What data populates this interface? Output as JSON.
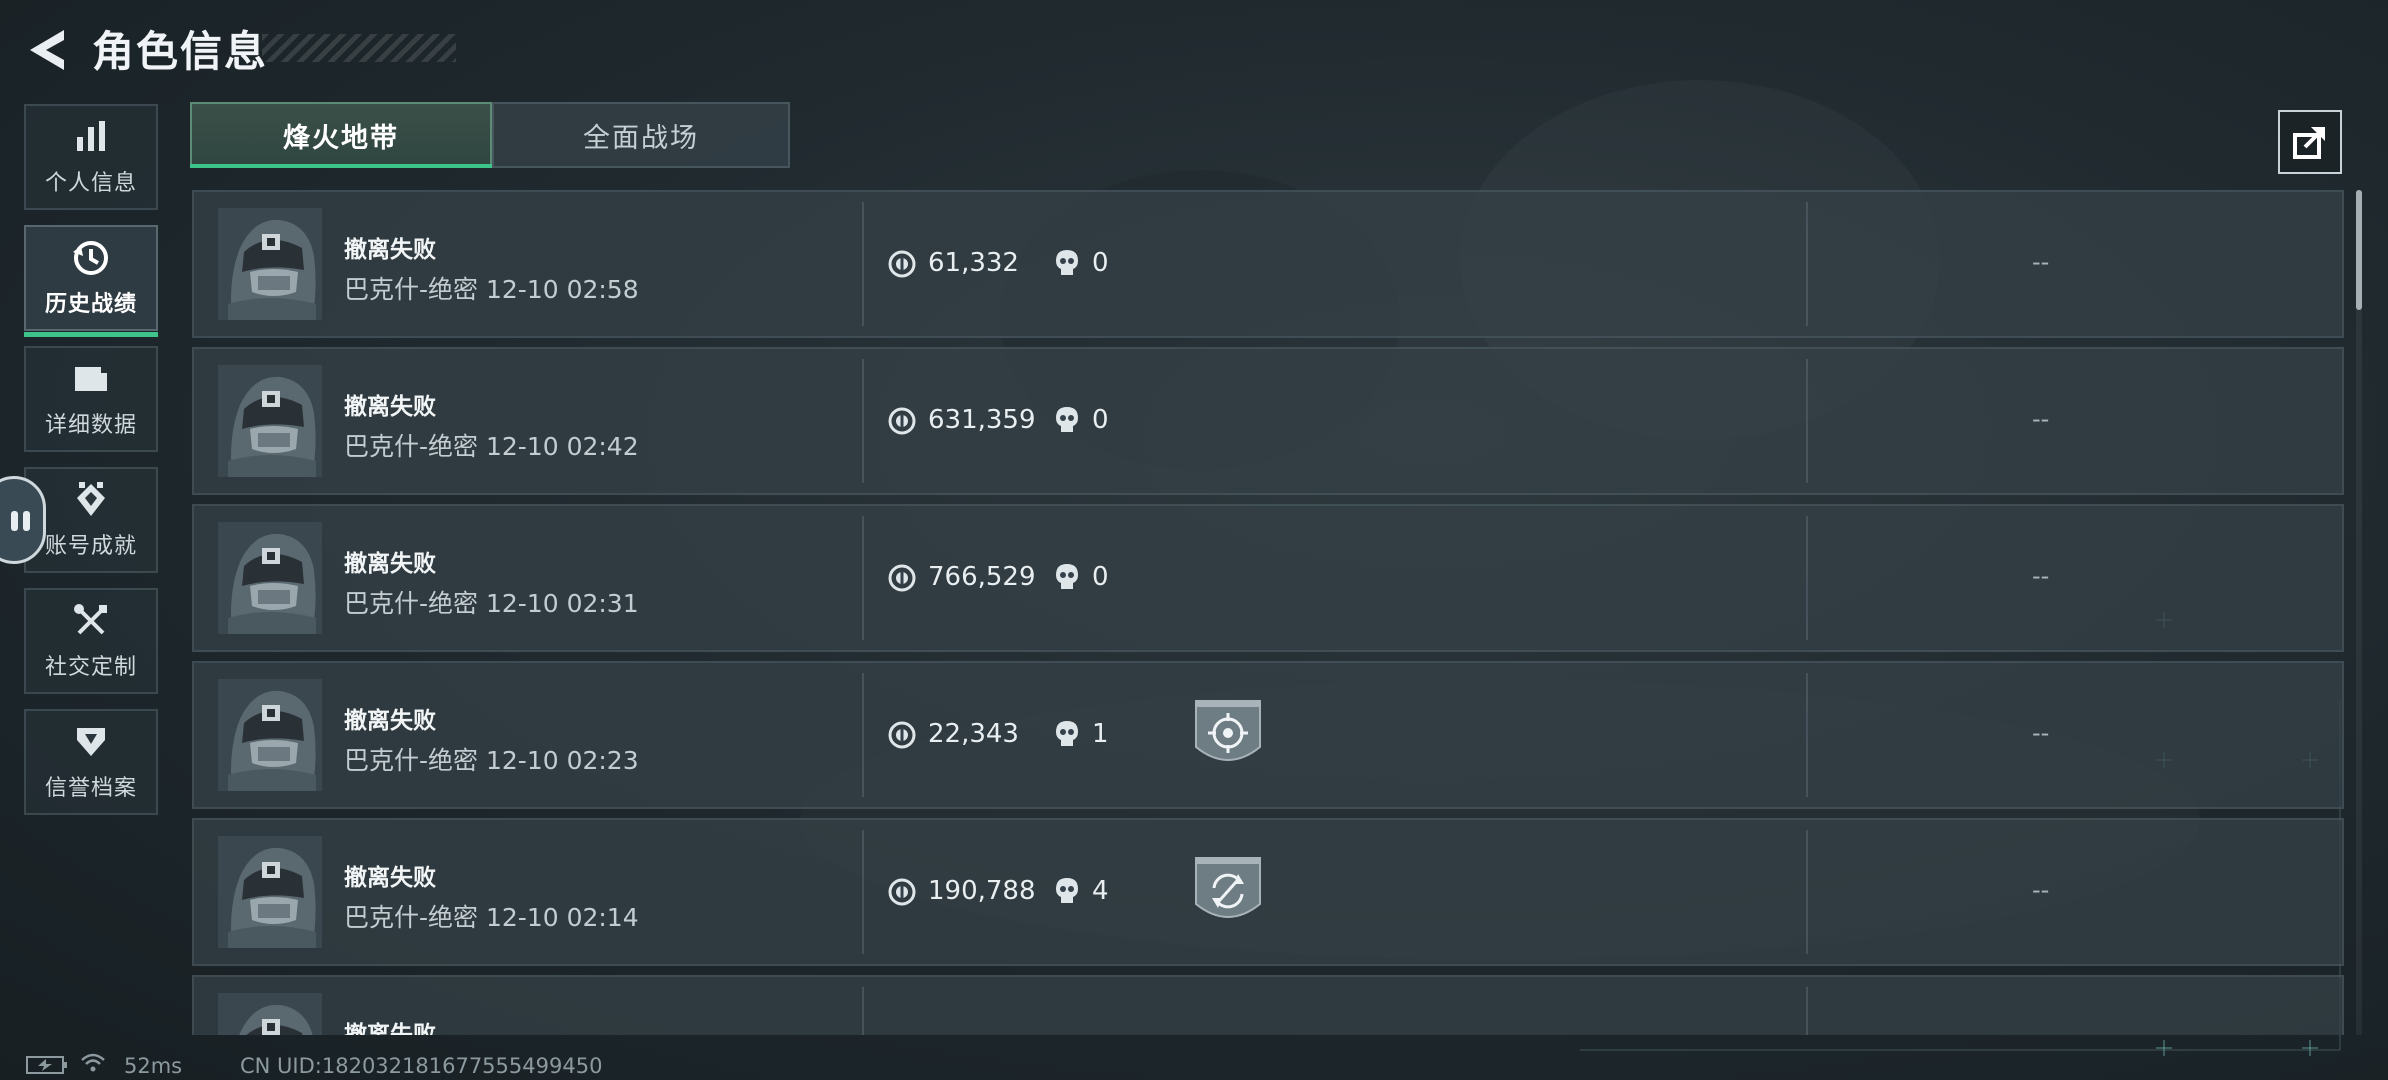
{
  "header": {
    "title": "角色信息",
    "back_icon": "back-arrow-icon"
  },
  "sidebar": {
    "items": [
      {
        "label": "个人信息",
        "icon": "bar-chart-icon",
        "active": false
      },
      {
        "label": "历史战绩",
        "icon": "history-clock-icon",
        "active": true
      },
      {
        "label": "详细数据",
        "icon": "folder-icon",
        "active": false
      },
      {
        "label": "账号成就",
        "icon": "achievement-badge-icon",
        "active": false
      },
      {
        "label": "社交定制",
        "icon": "tools-icon",
        "active": false
      },
      {
        "label": "信誉档案",
        "icon": "shield-down-icon",
        "active": false
      }
    ]
  },
  "tabs": [
    {
      "label": "烽火地带",
      "active": true
    },
    {
      "label": "全面战场",
      "active": false
    }
  ],
  "share_icon": "share-export-icon",
  "matches": [
    {
      "result": "撤离失败",
      "map": "巴克什-绝密",
      "time": "12-10 02:58",
      "value": "61,332",
      "kills": "0",
      "badge": "",
      "extra": "--"
    },
    {
      "result": "撤离失败",
      "map": "巴克什-绝密",
      "time": "12-10 02:42",
      "value": "631,359",
      "kills": "0",
      "badge": "",
      "extra": "--"
    },
    {
      "result": "撤离失败",
      "map": "巴克什-绝密",
      "time": "12-10 02:31",
      "value": "766,529",
      "kills": "0",
      "badge": "",
      "extra": "--"
    },
    {
      "result": "撤离失败",
      "map": "巴克什-绝密",
      "time": "12-10 02:23",
      "value": "22,343",
      "kills": "1",
      "badge": "crosshair-shield-badge-icon",
      "extra": "--"
    },
    {
      "result": "撤离失败",
      "map": "巴克什-绝密",
      "time": "12-10 02:14",
      "value": "190,788",
      "kills": "4",
      "badge": "refresh-shield-badge-icon",
      "extra": "--"
    },
    {
      "result": "撤离失败",
      "map": "",
      "time": "",
      "value": "",
      "kills": "",
      "badge": "",
      "extra": ""
    }
  ],
  "footer": {
    "latency": "52ms",
    "uid": "CN UID:182032181677555499450"
  },
  "colors": {
    "accent": "#3ec48a",
    "panel": "#34404a"
  }
}
